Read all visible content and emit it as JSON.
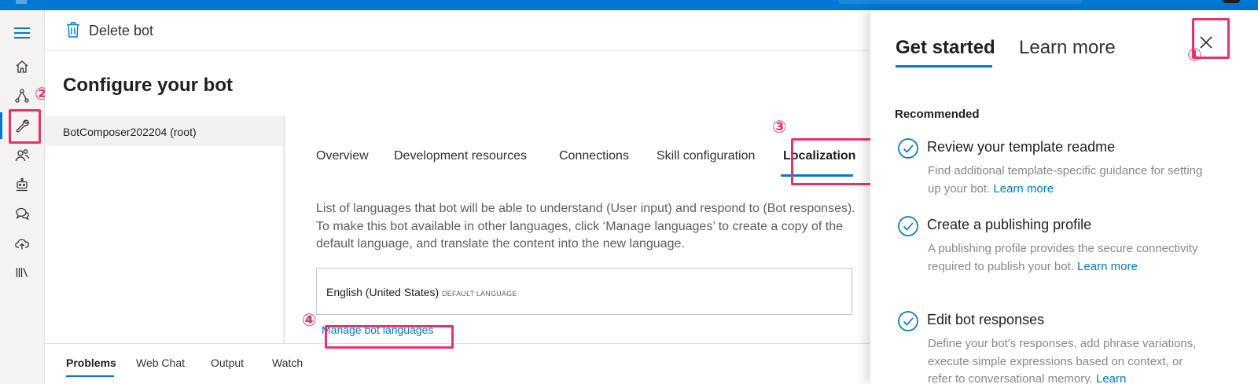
{
  "toolbar": {
    "delete_label": "Delete bot"
  },
  "page": {
    "title": "Configure your bot"
  },
  "left_nav": {
    "root_item": "BotComposer202204 (root)"
  },
  "tabs": [
    {
      "label": "Overview"
    },
    {
      "label": "Development resources"
    },
    {
      "label": "Connections"
    },
    {
      "label": "Skill configuration"
    },
    {
      "label": "Localization"
    }
  ],
  "localization": {
    "description": "List of languages that bot will be able to understand (User input) and respond to (Bot responses). To make this bot available in other languages, click ‘Manage languages’ to create a copy of the default language, and translate the content into the new language.",
    "language": "English (United States)",
    "default_tag": "DEFAULT LANGUAGE",
    "manage_link": "Manage bot languages"
  },
  "bottom_tabs": [
    {
      "label": "Problems"
    },
    {
      "label": "Web Chat"
    },
    {
      "label": "Output"
    },
    {
      "label": "Watch"
    }
  ],
  "panel": {
    "tab_get_started": "Get started",
    "tab_learn_more": "Learn more",
    "section": "Recommended",
    "items": [
      {
        "title": "Review your template readme",
        "desc": "Find additional template-specific guidance for setting up your bot.",
        "link": "Learn more"
      },
      {
        "title": "Create a publishing profile",
        "desc": "A publishing profile provides the secure connectivity required to publish your bot.",
        "link": "Learn more"
      },
      {
        "title": "Edit bot responses",
        "desc": "Define your bot's responses, add phrase variations, execute simple expressions based on context, or refer to conversational memory.",
        "link": "Learn"
      }
    ]
  },
  "annotations": {
    "n1": "①",
    "n2": "②",
    "n3": "③",
    "n4": "④"
  },
  "colors": {
    "accent": "#0078d4",
    "annotation": "#e8326d",
    "topbar": "#0078d4"
  },
  "rail_icons": [
    "menu-icon",
    "home-icon",
    "flow-icon",
    "wrench-icon",
    "users-icon",
    "bot-icon",
    "chat-icon",
    "cloud-upload-icon",
    "library-icon"
  ]
}
